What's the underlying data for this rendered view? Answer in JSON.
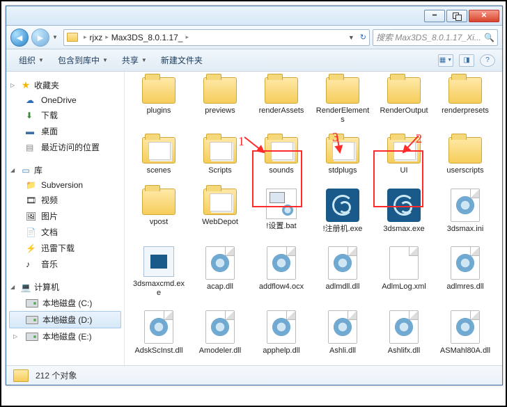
{
  "titlebar": {
    "min": "",
    "max": "",
    "close": ""
  },
  "nav": {
    "crumbs": [
      "rjxz",
      "Max3DS_8.0.1.17_"
    ],
    "search_placeholder": "搜索 Max3DS_8.0.1.17_Xi..."
  },
  "toolbar": {
    "organize": "组织",
    "include": "包含到库中",
    "share": "共享",
    "newfolder": "新建文件夹"
  },
  "sidebar": {
    "favorites": {
      "label": "收藏夹",
      "items": [
        "OneDrive",
        "下载",
        "桌面",
        "最近访问的位置"
      ]
    },
    "libraries": {
      "label": "库",
      "items": [
        "Subversion",
        "视频",
        "图片",
        "文档",
        "迅雷下载",
        "音乐"
      ]
    },
    "computer": {
      "label": "计算机",
      "items": [
        "本地磁盘 (C:)",
        "本地磁盘 (D:)",
        "本地磁盘 (E:)"
      ],
      "selected": 1
    }
  },
  "files": [
    {
      "name": "plugins",
      "type": "folder"
    },
    {
      "name": "previews",
      "type": "folder"
    },
    {
      "name": "renderAssets",
      "type": "folder"
    },
    {
      "name": "RenderElements",
      "type": "folder"
    },
    {
      "name": "RenderOutput",
      "type": "folder"
    },
    {
      "name": "renderpresets",
      "type": "folder"
    },
    {
      "name": "scenes",
      "type": "folder-stuff"
    },
    {
      "name": "Scripts",
      "type": "folder-stuff"
    },
    {
      "name": "sounds",
      "type": "folder-stuff"
    },
    {
      "name": "stdplugs",
      "type": "folder-stuff"
    },
    {
      "name": "UI",
      "type": "folder-stuff"
    },
    {
      "name": "userscripts",
      "type": "folder"
    },
    {
      "name": "vpost",
      "type": "folder"
    },
    {
      "name": "WebDepot",
      "type": "folder-stuff"
    },
    {
      "name": "!设置.bat",
      "type": "bat"
    },
    {
      "name": "!注册机.exe",
      "type": "max"
    },
    {
      "name": "3dsmax.exe",
      "type": "max"
    },
    {
      "name": "3dsmax.ini",
      "type": "gear"
    },
    {
      "name": "3dsmaxcmd.exe",
      "type": "exe"
    },
    {
      "name": "acap.dll",
      "type": "gear"
    },
    {
      "name": "addflow4.ocx",
      "type": "gear"
    },
    {
      "name": "adlmdll.dll",
      "type": "gear"
    },
    {
      "name": "AdlmLog.xml",
      "type": "page"
    },
    {
      "name": "adlmres.dll",
      "type": "gear"
    },
    {
      "name": "AdskScInst.dll",
      "type": "gear"
    },
    {
      "name": "Amodeler.dll",
      "type": "gear"
    },
    {
      "name": "apphelp.dll",
      "type": "gear"
    },
    {
      "name": "Ashli.dll",
      "type": "gear"
    },
    {
      "name": "Ashlifx.dll",
      "type": "gear"
    },
    {
      "name": "ASMahl80A.dll",
      "type": "gear"
    }
  ],
  "annotations": {
    "n1": "1",
    "n2": "2",
    "n3": "3"
  },
  "status": {
    "count": "212 个对象"
  }
}
